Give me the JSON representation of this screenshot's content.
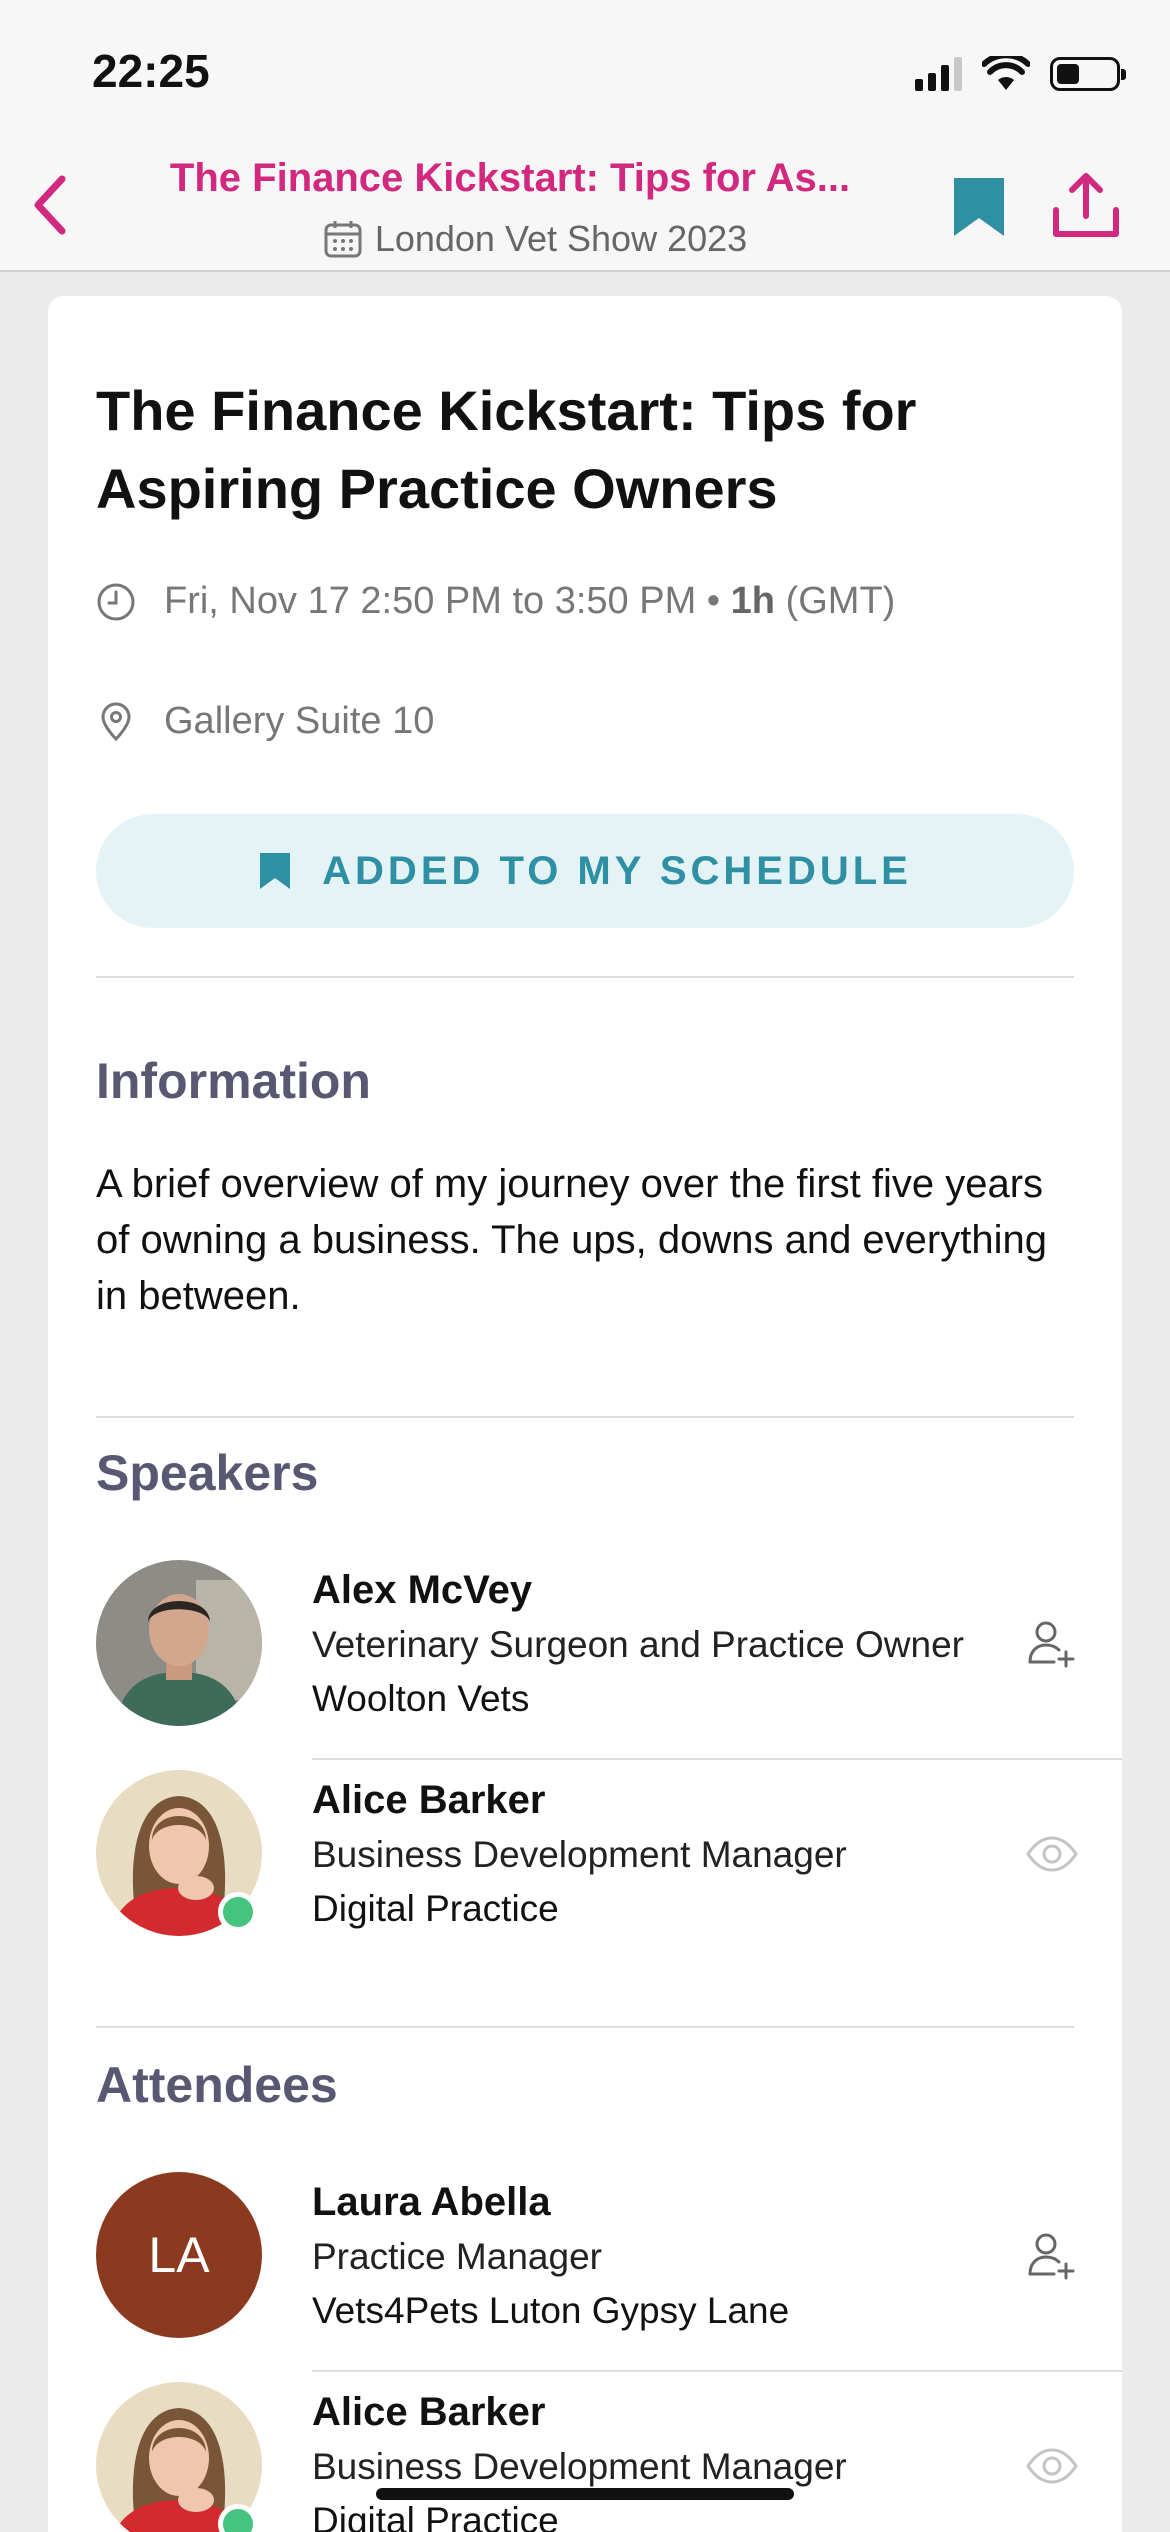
{
  "status_bar": {
    "time": "22:25",
    "battery_level": 0.4
  },
  "nav": {
    "title": "The Finance Kickstart: Tips for As...",
    "subtitle": "London Vet Show 2023",
    "accent_color": "#d2287f",
    "bookmark_color": "#2f8fa3"
  },
  "session": {
    "title": "The Finance Kickstart: Tips for Aspiring Practice Owners",
    "time_text": "Fri, Nov 17 2:50 PM to 3:50 PM •",
    "duration": "1h",
    "timezone": "(GMT)",
    "location": "Gallery Suite 10",
    "schedule_button_label": "ADDED TO MY SCHEDULE"
  },
  "information": {
    "heading": "Information",
    "body": "A brief overview of my journey over the first five years of owning a business. The ups, downs and everything in between."
  },
  "speakers": {
    "heading": "Speakers",
    "items": [
      {
        "name": "Alex McVey",
        "role": "Veterinary Surgeon and Practice Owner",
        "org": "Woolton Vets",
        "action_icon": "add-contact-icon",
        "online": false
      },
      {
        "name": "Alice Barker",
        "role": "Business Development Manager",
        "org": "Digital Practice",
        "action_icon": "eye-icon",
        "online": true
      }
    ]
  },
  "attendees": {
    "heading": "Attendees",
    "items": [
      {
        "name": "Laura Abella",
        "initials": "LA",
        "role": "Practice Manager",
        "org": "Vets4Pets Luton Gypsy Lane",
        "action_icon": "add-contact-icon",
        "online": false
      },
      {
        "name": "Alice Barker",
        "role": "Business Development Manager",
        "org": "Digital Practice",
        "action_icon": "eye-icon",
        "online": true
      }
    ]
  }
}
